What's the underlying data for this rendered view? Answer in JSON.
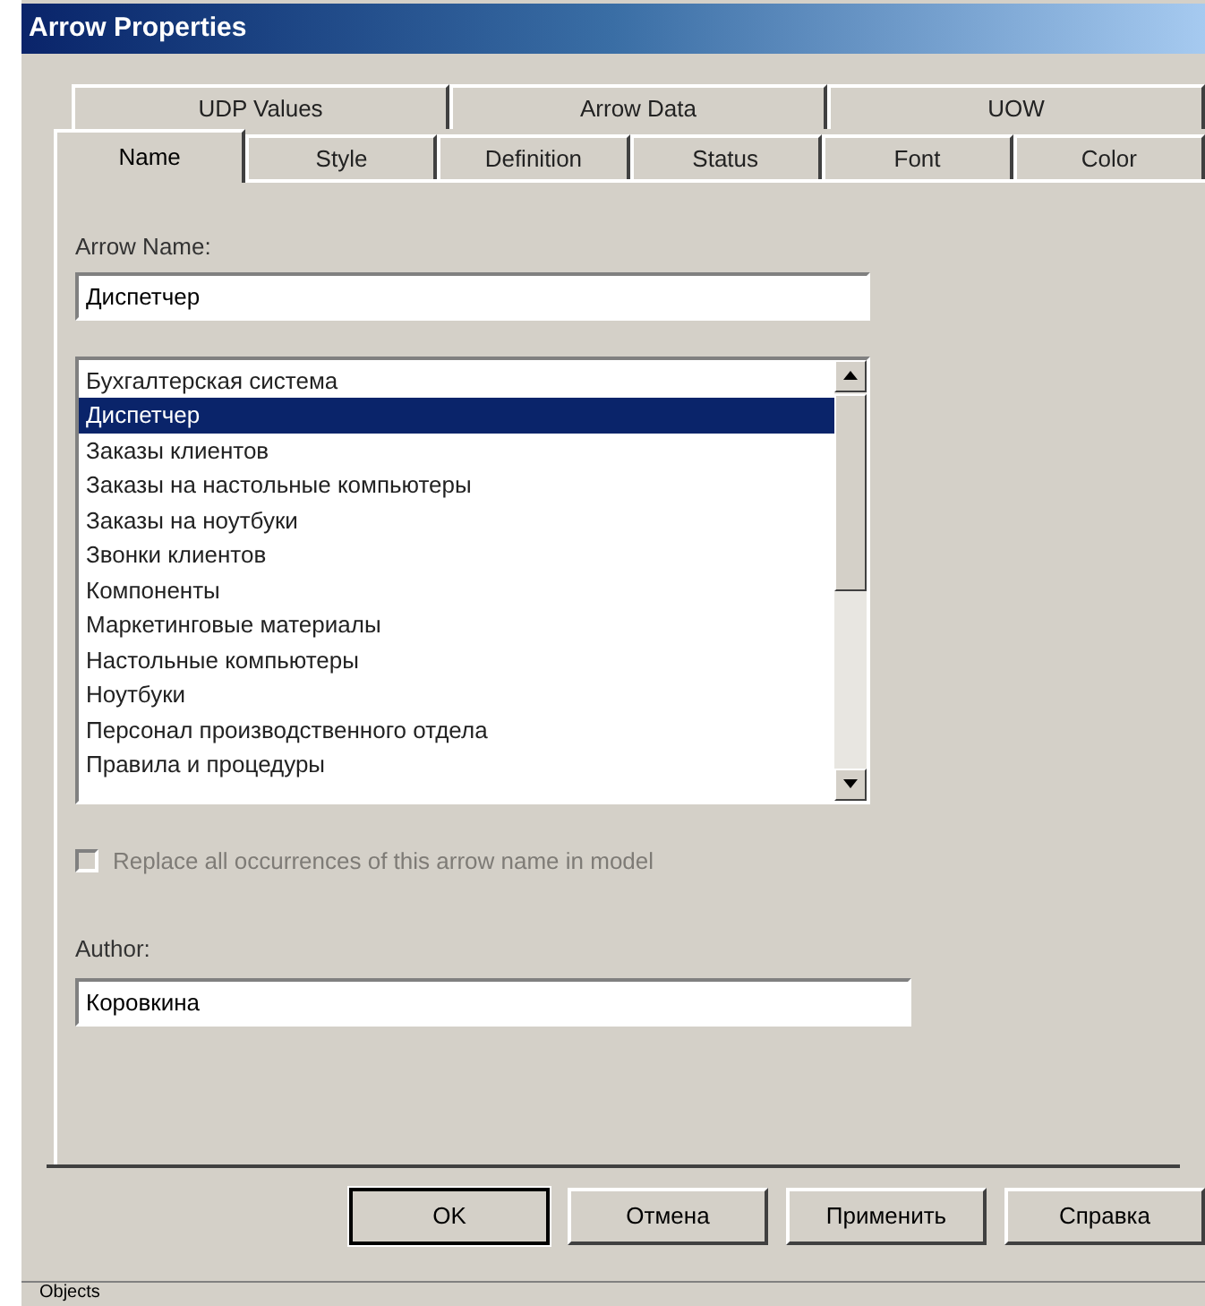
{
  "window": {
    "title": "Arrow Properties"
  },
  "tab_rows": [
    [
      {
        "label": "UDP Values",
        "selected": false
      },
      {
        "label": "Arrow Data",
        "selected": false
      },
      {
        "label": "UOW",
        "selected": false
      }
    ],
    [
      {
        "label": "Name",
        "selected": true
      },
      {
        "label": "Style",
        "selected": false
      },
      {
        "label": "Definition",
        "selected": false
      },
      {
        "label": "Status",
        "selected": false
      },
      {
        "label": "Font",
        "selected": false
      },
      {
        "label": "Color",
        "selected": false
      }
    ]
  ],
  "arrow_name": {
    "label": "Arrow Name:",
    "value": "Диспетчер"
  },
  "name_list": [
    {
      "label": "Бухгалтерская система",
      "selected": false
    },
    {
      "label": "Диспетчер",
      "selected": true
    },
    {
      "label": "Заказы клиентов",
      "selected": false
    },
    {
      "label": "Заказы на настольные компьютеры",
      "selected": false
    },
    {
      "label": "Заказы на ноутбуки",
      "selected": false
    },
    {
      "label": "Звонки клиентов",
      "selected": false
    },
    {
      "label": "Компоненты",
      "selected": false
    },
    {
      "label": "Маркетинговые материалы",
      "selected": false
    },
    {
      "label": "Настольные компьютеры",
      "selected": false
    },
    {
      "label": "Ноутбуки",
      "selected": false
    },
    {
      "label": "Персонал производственного отдела",
      "selected": false
    },
    {
      "label": "Правила и процедуры",
      "selected": false
    }
  ],
  "replace_checkbox": {
    "label": "Replace all occurrences of this arrow name in model",
    "checked": false,
    "disabled": true
  },
  "author": {
    "label": "Author:",
    "value": "Коровкина"
  },
  "buttons": [
    {
      "label": "OK",
      "default": true
    },
    {
      "label": "Отмена",
      "default": false
    },
    {
      "label": "Применить",
      "default": false
    },
    {
      "label": "Справка",
      "default": false
    }
  ],
  "taskbar": {
    "label": "Objects"
  }
}
